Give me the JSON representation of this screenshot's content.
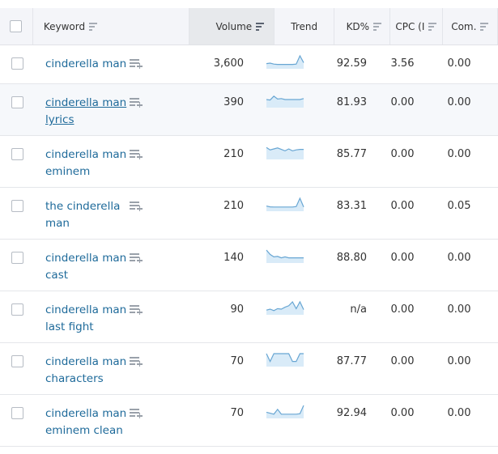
{
  "header": {
    "columns": [
      {
        "key": "select_all",
        "label": ""
      },
      {
        "key": "keyword",
        "label": "Keyword"
      },
      {
        "key": "volume",
        "label": "Volume"
      },
      {
        "key": "trend",
        "label": "Trend"
      },
      {
        "key": "kd",
        "label": "KD%"
      },
      {
        "key": "cpc",
        "label": "CPC (I"
      },
      {
        "key": "com",
        "label": "Com."
      }
    ],
    "sorted_column": "volume"
  },
  "icons": {
    "sort": "sort-lines-icon",
    "add_to_list": "add-to-list-icon",
    "checkbox": "checkbox-unchecked"
  },
  "colors": {
    "link": "#1e6a9a",
    "sparkline_stroke": "#68a6d3",
    "sparkline_fill": "#d9ebf8",
    "header_bg": "#f4f5f9",
    "sorted_header_bg": "#e7e9ec"
  },
  "rows": [
    {
      "keyword": "cinderella man",
      "volume": "3,600",
      "kd": "92.59",
      "cpc": "3.56",
      "com": "0.00",
      "trend": [
        0.2,
        0.25,
        0.15,
        0.12,
        0.12,
        0.12,
        0.12,
        0.12,
        0.15,
        1.0,
        0.3
      ]
    },
    {
      "keyword": "cinderella man lyrics",
      "volume": "390",
      "kd": "81.93",
      "cpc": "0.00",
      "com": "0.00",
      "trend": [
        0.5,
        0.45,
        0.85,
        0.55,
        0.6,
        0.5,
        0.5,
        0.5,
        0.5,
        0.5,
        0.6
      ],
      "hover": true
    },
    {
      "keyword": "cinderella man eminem",
      "volume": "210",
      "kd": "85.77",
      "cpc": "0.00",
      "com": "0.00",
      "trend": [
        0.9,
        0.65,
        0.75,
        0.85,
        0.7,
        0.55,
        0.75,
        0.55,
        0.65,
        0.7,
        0.7
      ]
    },
    {
      "keyword": "the cinderella man",
      "volume": "210",
      "kd": "83.31",
      "cpc": "0.00",
      "com": "0.05",
      "trend": [
        0.2,
        0.12,
        0.1,
        0.1,
        0.1,
        0.1,
        0.1,
        0.1,
        0.15,
        1.0,
        0.1
      ]
    },
    {
      "keyword": "cinderella man cast",
      "volume": "140",
      "kd": "88.80",
      "cpc": "0.00",
      "com": "0.00",
      "trend": [
        1.0,
        0.55,
        0.3,
        0.35,
        0.2,
        0.3,
        0.2,
        0.2,
        0.2,
        0.2,
        0.2
      ]
    },
    {
      "keyword": "cinderella man last fight",
      "volume": "90",
      "kd": "n/a",
      "cpc": "0.00",
      "com": "0.00",
      "trend": [
        0.15,
        0.25,
        0.1,
        0.3,
        0.25,
        0.45,
        0.6,
        1.0,
        0.3,
        1.0,
        0.2
      ]
    },
    {
      "keyword": "cinderella man characters",
      "volume": "70",
      "kd": "87.77",
      "cpc": "0.00",
      "com": "0.00",
      "trend": [
        1.0,
        0.2,
        1.0,
        1.0,
        1.0,
        1.0,
        1.0,
        0.2,
        0.2,
        1.0,
        1.0
      ]
    },
    {
      "keyword": "cinderella man eminem clean",
      "volume": "70",
      "kd": "92.94",
      "cpc": "0.00",
      "com": "0.00",
      "trend": [
        0.3,
        0.2,
        0.1,
        0.6,
        0.1,
        0.1,
        0.1,
        0.1,
        0.1,
        0.15,
        1.0
      ]
    }
  ]
}
